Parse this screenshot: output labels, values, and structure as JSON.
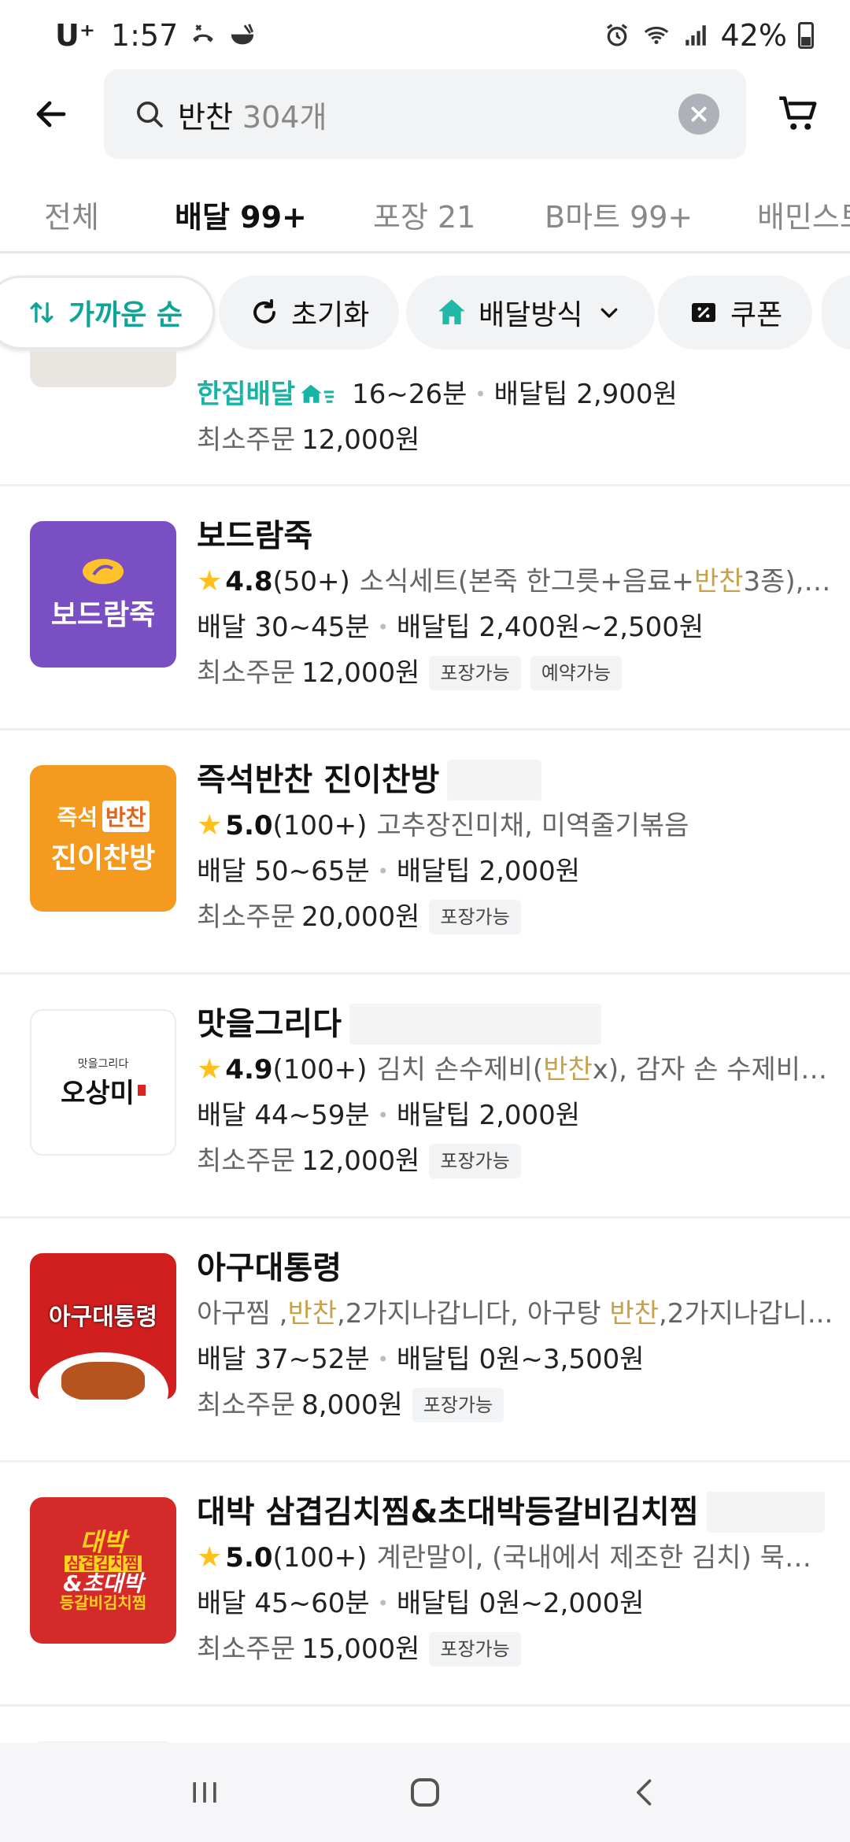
{
  "status_bar": {
    "carrier": "U⁺",
    "time": "1:57",
    "battery": "42%",
    "icons": [
      "phone-missed-icon",
      "bowl-icon",
      "alarm-icon",
      "wifi-icon",
      "signal-icon",
      "battery-icon"
    ]
  },
  "search": {
    "query": "반찬",
    "count": "304개"
  },
  "tabs": [
    {
      "label": "전체",
      "active": false
    },
    {
      "label": "배달 99+",
      "active": true
    },
    {
      "label": "포장 21",
      "active": false
    },
    {
      "label": "B마트 99+",
      "active": false
    },
    {
      "label": "배민스토",
      "active": false
    }
  ],
  "chips": {
    "sort": "가까운 순",
    "reset": "초기화",
    "delivery_method": "배달방식",
    "coupon": "쿠폰"
  },
  "colors": {
    "accent": "#0fa596",
    "highlight": "#c8a24a",
    "star": "#ffc01e"
  },
  "stores": [
    {
      "partial": true,
      "hanjip_label": "한집배달",
      "time": "16~26분",
      "tip": "배달팁 2,900원",
      "min_label": "최소주문",
      "min_value": "12,000원"
    },
    {
      "name": "보드람죽",
      "logo_text": "보드람죽",
      "logo_bg": "#7b4fc4",
      "rating": "4.8",
      "review_count": "(50+)",
      "desc_parts": [
        "소식세트(본죽 한그릇+음료+",
        "반찬",
        "3종), 3..."
      ],
      "delivery": "배달 30~45분",
      "tip": "배달팁 2,400원~2,500원",
      "min_label": "최소주문",
      "min_value": "12,000원",
      "badges": [
        "포장가능",
        "예약가능"
      ]
    },
    {
      "name": "즉석반찬 진이찬방",
      "logo_top_left": "즉석",
      "logo_top_right": "반찬",
      "logo_bottom": "진이찬방",
      "logo_bg": "#f39a1f",
      "rating": "5.0",
      "review_count": "(100+)",
      "desc_parts": [
        "고추장진미채, 미역줄기볶음"
      ],
      "delivery": "배달 50~65분",
      "tip": "배달팁 2,000원",
      "min_label": "최소주문",
      "min_value": "20,000원",
      "badges": [
        "포장가능"
      ]
    },
    {
      "name": "맛을그리다",
      "logo_small": "맛을그리다",
      "logo_text": "오상미",
      "logo_bg": "#ffffff",
      "rating": "4.9",
      "review_count": "(100+)",
      "desc_parts": [
        "김치 손수제비(",
        "반찬",
        "x), 감자 손 수제비(..."
      ],
      "delivery": "배달 44~59분",
      "tip": "배달팁 2,000원",
      "min_label": "최소주문",
      "min_value": "12,000원",
      "badges": [
        "포장가능"
      ]
    },
    {
      "name": "아구대통령",
      "logo_text": "아구대통령",
      "logo_bg": "#d11f1f",
      "desc_parts": [
        "아구찜 ,",
        "반찬",
        ",2가지나갑니다, 아구탕 ",
        "반찬",
        ",2가지나갑니..."
      ],
      "delivery": "배달 37~52분",
      "tip": "배달팁 0원~3,500원",
      "min_label": "최소주문",
      "min_value": "8,000원",
      "badges": [
        "포장가능"
      ]
    },
    {
      "name": "대박 삼겹김치찜&초대박등갈비김치찜",
      "logo_lines": [
        "대박",
        "삼겹김치찜",
        "&초대박",
        "등갈비김치찜"
      ],
      "logo_bg": "#d42a2a",
      "rating": "5.0",
      "review_count": "(100+)",
      "desc_parts": [
        "계란말이, (국내에서 제조한 김치) 묵은..."
      ],
      "delivery": "배달 45~60분",
      "tip": "배달팁 0원~2,000원",
      "min_label": "최소주문",
      "min_value": "15,000원",
      "badges": [
        "포장가능"
      ]
    }
  ],
  "nav": [
    "recent-apps-icon",
    "home-icon",
    "back-icon"
  ]
}
